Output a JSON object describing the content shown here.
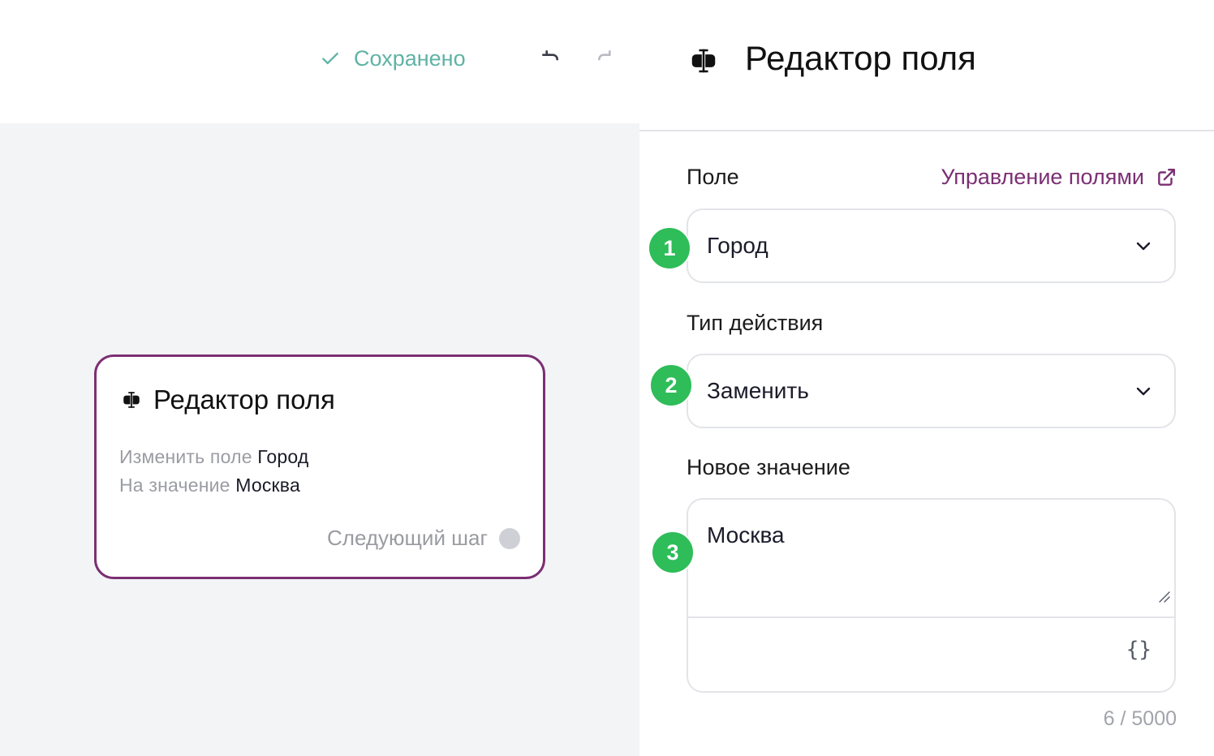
{
  "topbar": {
    "status_label": "Сохранено",
    "status_icon": "check-icon",
    "undo_icon": "undo-icon",
    "redo_icon": "redo-icon",
    "status_color": "#5fb3a5"
  },
  "node": {
    "title": "Редактор поля",
    "icon": "text-cursor-icon",
    "line1_prefix": "Изменить поле",
    "line1_value": "Город",
    "line2_prefix": "На значение",
    "line2_value": "Москва",
    "next_label": "Следующий шаг",
    "border_color": "#7b2f74"
  },
  "panel": {
    "title": "Редактор поля",
    "icon": "text-cursor-icon",
    "field_label": "Поле",
    "manage_link": "Управление полями",
    "manage_link_icon": "external-link-icon",
    "field_value": "Город",
    "action_label": "Тип действия",
    "action_value": "Заменить",
    "new_value_label": "Новое значение",
    "new_value": "Москва",
    "variables_button": "{}",
    "char_counter": "6 / 5000",
    "badges": [
      "1",
      "2",
      "3"
    ],
    "badge_color": "#2ebd59",
    "link_color": "#7b2f74"
  }
}
